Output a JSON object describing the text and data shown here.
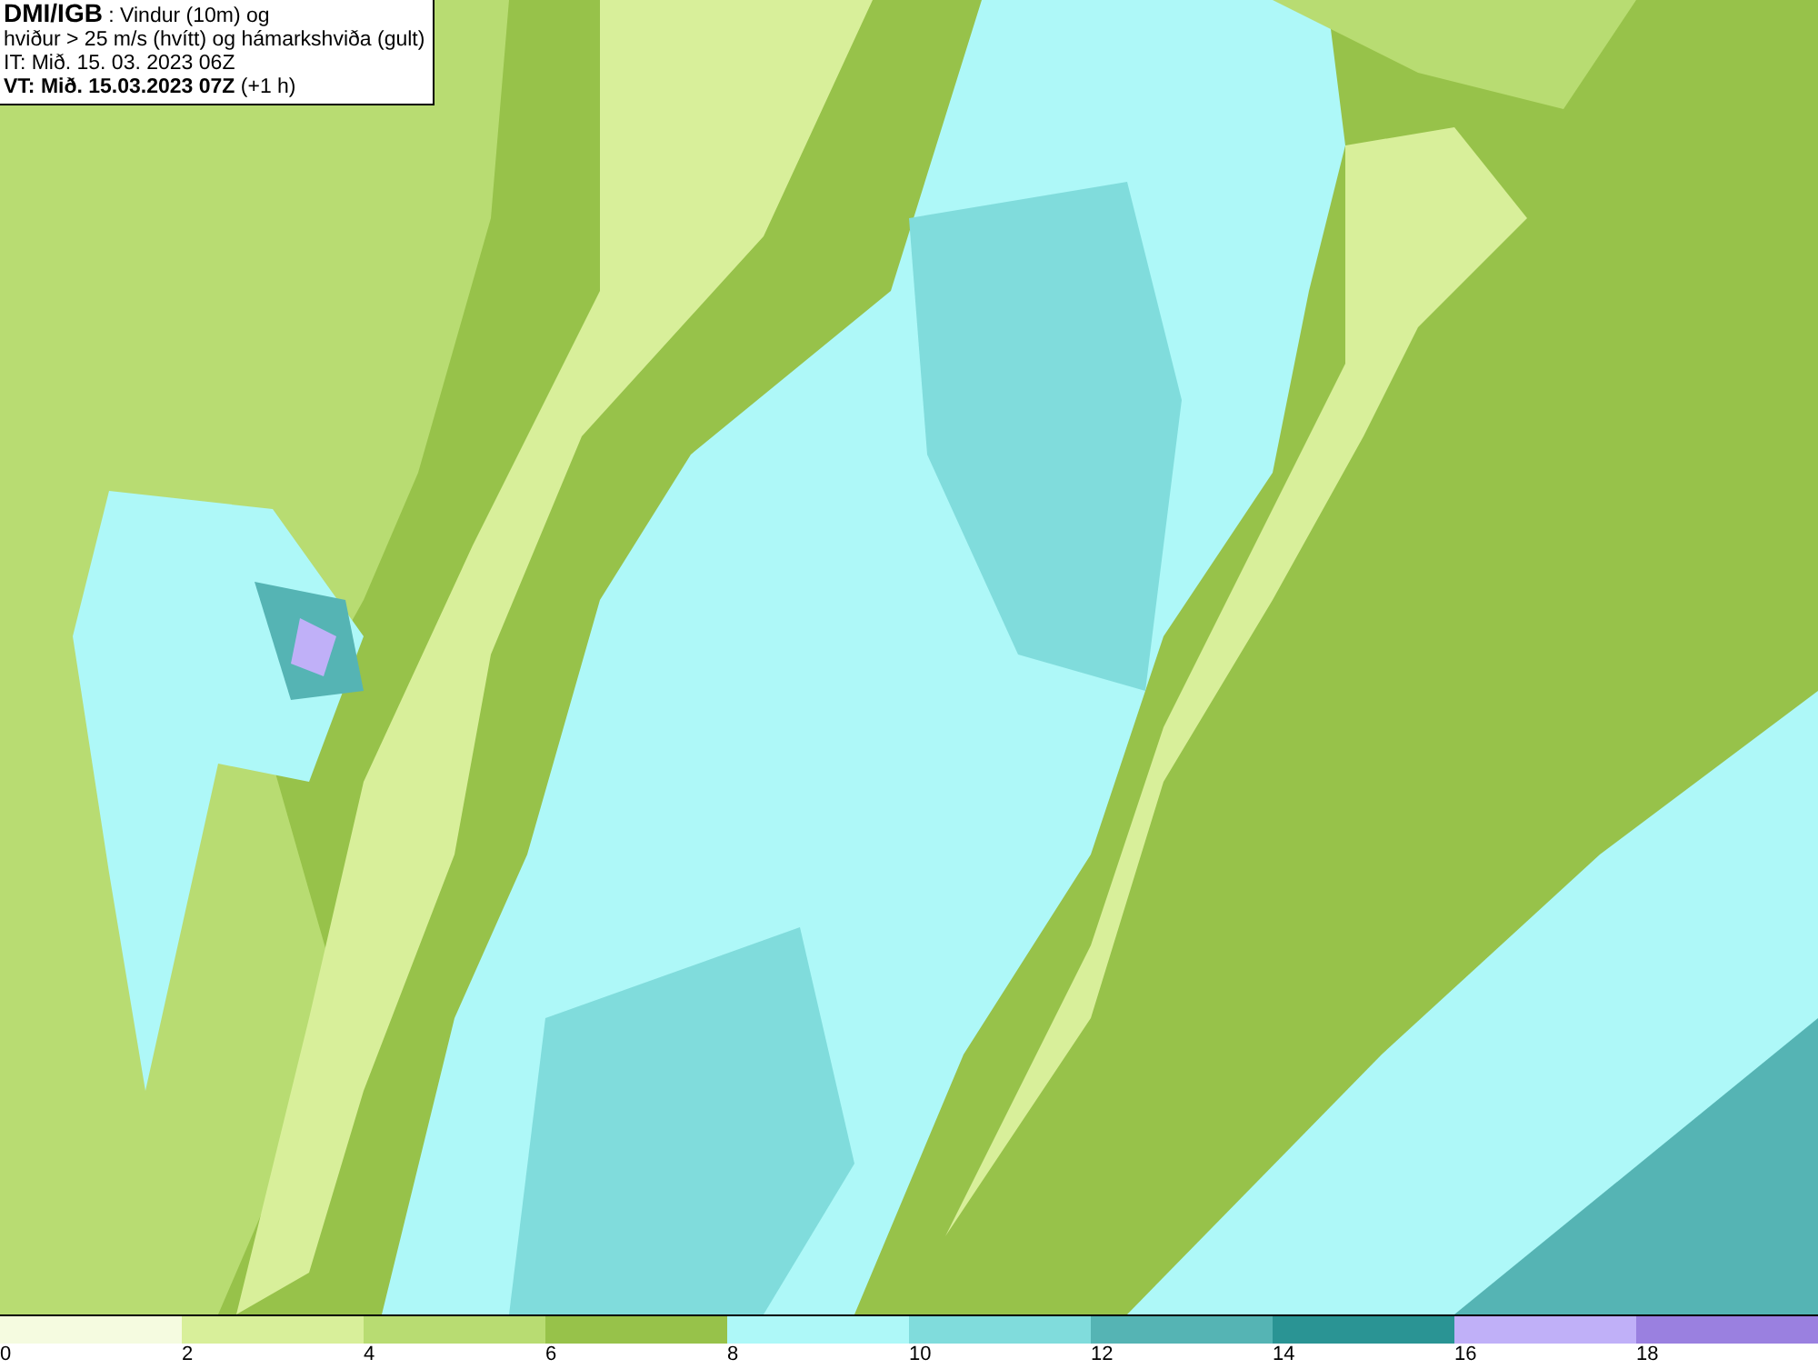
{
  "title_box": {
    "lines": [
      "**DMI/IGB** : Vindur (10m) og",
      "hviður > 25 m/s (hvítt) og hámarkshviða (gult)",
      "IT: Mið. 15. 03. 2023 06Z",
      "**VT: Mið. 15.03.2023 07Z** (+1 h)"
    ]
  },
  "legend": [
    {
      "label": "0",
      "color": "#f5fbe0"
    },
    {
      "label": "2",
      "color": "#d8ef9a"
    },
    {
      "label": "4",
      "color": "#b8dc72"
    },
    {
      "label": "6",
      "color": "#97c24a"
    },
    {
      "label": "8",
      "color": "#aef8f8"
    },
    {
      "label": "10",
      "color": "#80dcdc"
    },
    {
      "label": "12",
      "color": "#55b4b4"
    },
    {
      "label": "14",
      "color": "#2a9494"
    },
    {
      "label": "16",
      "color": "#c0b0f8"
    },
    {
      "label": "18",
      "color": "#9a80e0"
    }
  ]
}
